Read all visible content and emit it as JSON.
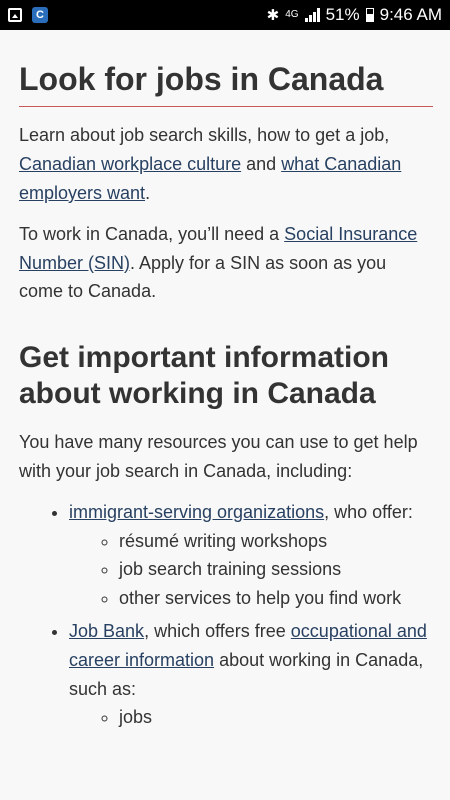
{
  "status_bar": {
    "network": "4G",
    "battery": "51%",
    "time": "9:46 AM",
    "app_icon_letter": "C"
  },
  "section1": {
    "title": "Look for jobs in Canada",
    "p1_text": "Learn about job search skills, how to get a job, ",
    "p1_link1": "Canadian workplace culture",
    "p1_and": " and ",
    "p1_link2": "what Canadian employers want",
    "p1_end": ".",
    "p2_text": "To work in Canada, you’ll need a ",
    "p2_link": "Social Insurance Number (SIN)",
    "p2_end": ". Apply for a SIN as soon as you come to Canada."
  },
  "section2": {
    "title": "Get important information about working in Canada",
    "intro": "You have many resources you can use to get help with your job search in Canada, including:",
    "item1_link": "immigrant-serving organizations",
    "item1_text": ", who offer:",
    "item1_sub": [
      "résumé writing workshops",
      "job search training sessions",
      "other services to help you find work"
    ],
    "item2_link": "Job Bank",
    "item2_text": ", which offers free ",
    "item2_link2": "occupational and career information",
    "item2_end": " about working in Canada, such as:",
    "item2_sub": [
      "jobs"
    ]
  }
}
